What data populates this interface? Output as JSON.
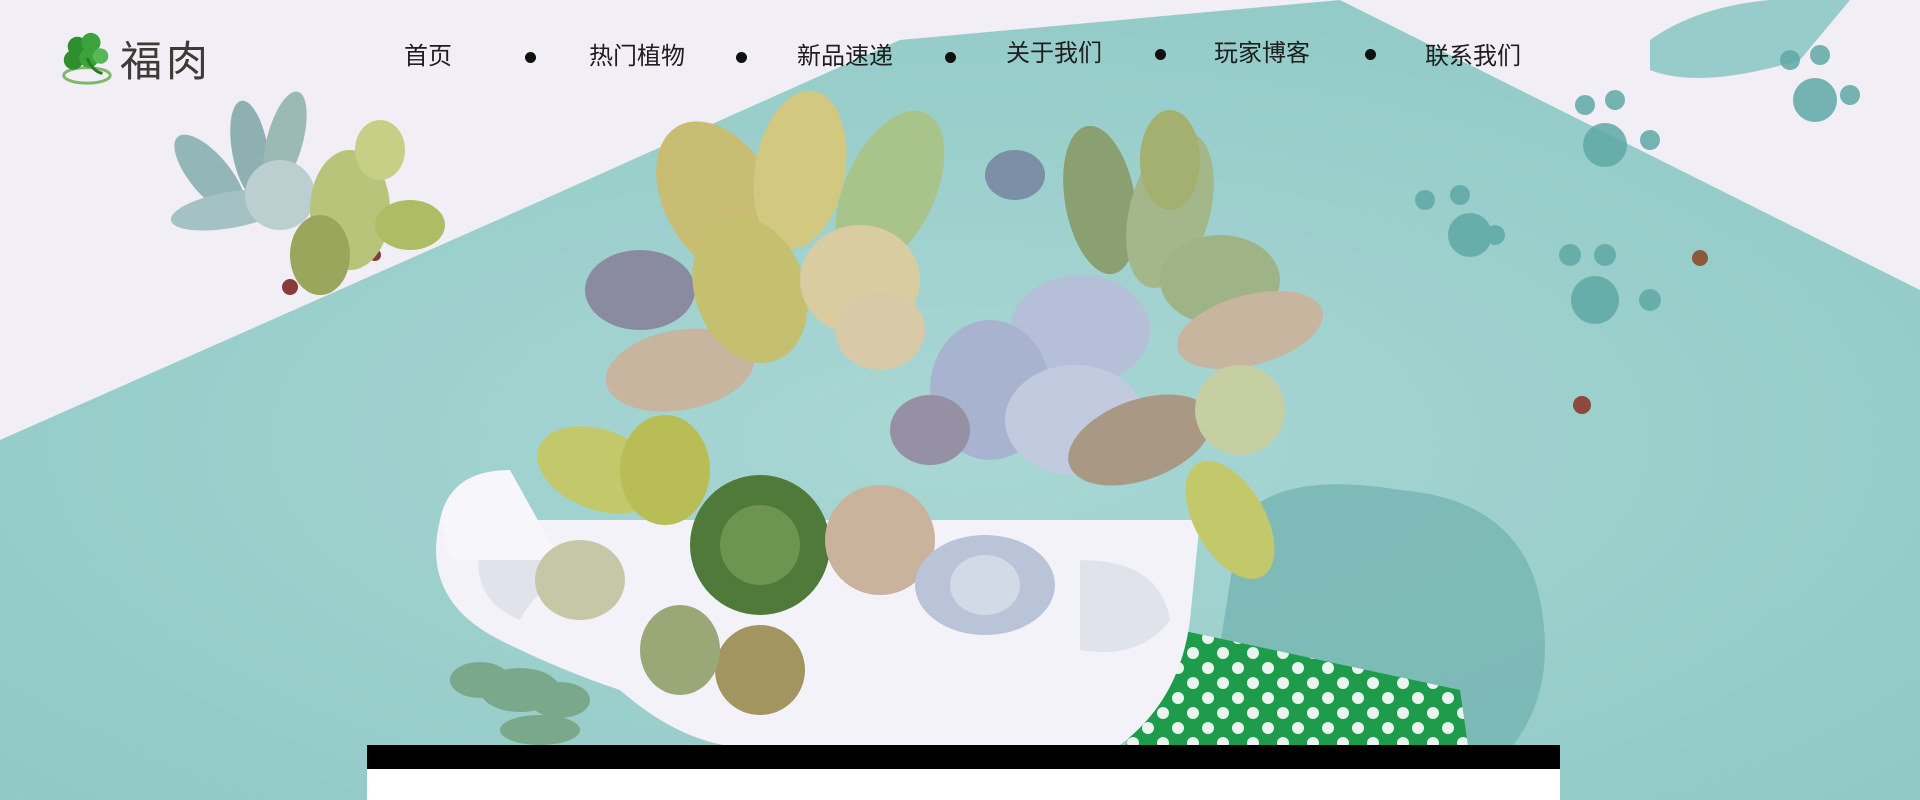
{
  "brand": {
    "name": "福肉",
    "logo_icon": "four-leaf-clover-icon",
    "brand_color": "#3a9a3a"
  },
  "nav": {
    "items": [
      {
        "label": "首页"
      },
      {
        "label": "热门植物"
      },
      {
        "label": "新品速递"
      },
      {
        "label": "关于我们"
      },
      {
        "label": "玩家博客"
      },
      {
        "label": "联系我们"
      }
    ],
    "separator_icon": "bullet-dot-icon"
  },
  "hero": {
    "illustration": "succulent-plants-in-teacup",
    "colors": {
      "background": "#f1eef6",
      "teal": "#9ed0cd",
      "teal_dark": "#6fb5b2",
      "cup_white": "#f4f3f8",
      "polka_green": "#1e9a4a"
    }
  },
  "content_box": {
    "top_bar_color": "#000000",
    "fill_color": "#ffffff"
  }
}
